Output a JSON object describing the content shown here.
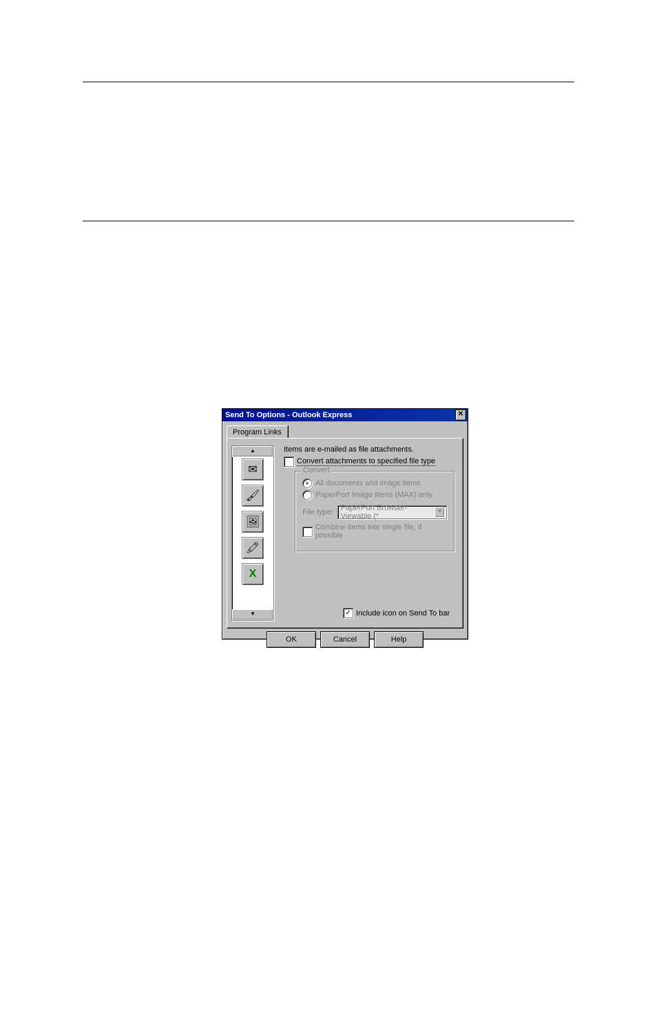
{
  "dialog": {
    "title": "Send To Options - Outlook Express",
    "tab_label": "Program Links",
    "info": "Items are e-mailed as file attachments.",
    "convert_checkbox": "Convert attachments to specified file type",
    "group": {
      "title": "Convert",
      "radio_all": "All documents and image items",
      "radio_max_only": "PaperPort Image items (MAX) only",
      "file_type_label": "File type:",
      "file_type_value": "PaperPort Browser-Viewable (*",
      "combine": "Combine items into single file, if possible"
    },
    "include_icon": "Include icon on Send To bar",
    "buttons": {
      "ok": "OK",
      "cancel": "Cancel",
      "help": "Help"
    },
    "link_icons": [
      {
        "name": "outlook-express-icon",
        "glyph": "✉"
      },
      {
        "name": "paint-program-icon",
        "glyph": "🖌"
      },
      {
        "name": "image-viewer-icon",
        "glyph": "🖼"
      },
      {
        "name": "draw-tool-icon",
        "glyph": "🖍"
      },
      {
        "name": "excel-icon",
        "glyph": "X"
      }
    ]
  }
}
